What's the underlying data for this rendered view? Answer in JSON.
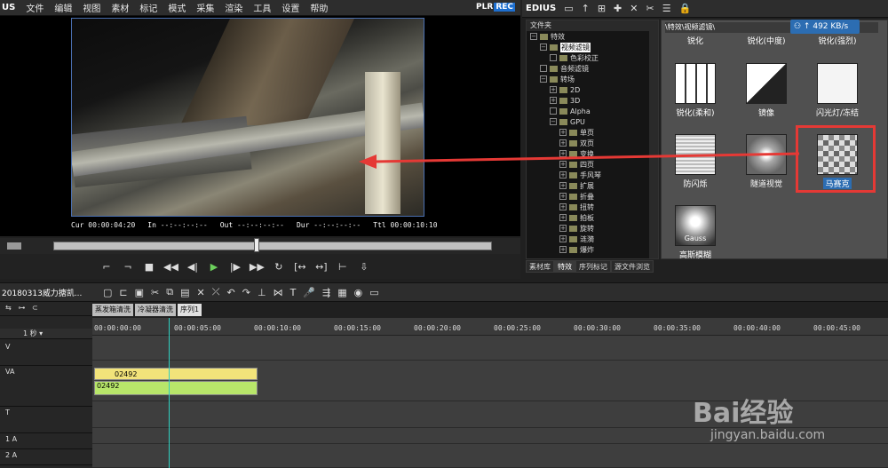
{
  "app": {
    "logo": "US",
    "menus": [
      "文件",
      "编辑",
      "视图",
      "素材",
      "标记",
      "模式",
      "采集",
      "渲染",
      "工具",
      "设置",
      "帮助"
    ],
    "plr": "PLR",
    "rec": "REC"
  },
  "player": {
    "cur_label": "Cur",
    "cur": "00:00:04:20",
    "in_label": "In",
    "in": "--:--:--:--",
    "out_label": "Out",
    "out": "--:--:--:--",
    "dur_label": "Dur",
    "dur": "--:--:--:--",
    "ttl_label": "Ttl",
    "ttl": "00:00:10:10"
  },
  "right": {
    "title": "EDIUS",
    "speed": "492 KB/s",
    "tree_header": "文件夹",
    "fx_path": "\\特效\\视频滤镜\\"
  },
  "tree": [
    {
      "label": "特效",
      "level": 0,
      "sign": "−"
    },
    {
      "label": "视频滤镜",
      "level": 1,
      "sign": "−",
      "selected": true
    },
    {
      "label": "色彩校正",
      "level": 2,
      "sign": ""
    },
    {
      "label": "音频滤镜",
      "level": 1,
      "sign": ""
    },
    {
      "label": "转场",
      "level": 1,
      "sign": "−"
    },
    {
      "label": "2D",
      "level": 2,
      "sign": "+"
    },
    {
      "label": "3D",
      "level": 2,
      "sign": "+"
    },
    {
      "label": "Alpha",
      "level": 2,
      "sign": ""
    },
    {
      "label": "GPU",
      "level": 2,
      "sign": "−"
    },
    {
      "label": "单页",
      "level": 3,
      "sign": "+"
    },
    {
      "label": "双页",
      "level": 3,
      "sign": "+"
    },
    {
      "label": "变换",
      "level": 3,
      "sign": "+"
    },
    {
      "label": "四页",
      "level": 3,
      "sign": "+"
    },
    {
      "label": "手风琴",
      "level": 3,
      "sign": "+"
    },
    {
      "label": "扩展",
      "level": 3,
      "sign": "+"
    },
    {
      "label": "折叠",
      "level": 3,
      "sign": "+"
    },
    {
      "label": "扭转",
      "level": 3,
      "sign": "+"
    },
    {
      "label": "拍板",
      "level": 3,
      "sign": "+"
    },
    {
      "label": "旋转",
      "level": 3,
      "sign": "+"
    },
    {
      "label": "涟漪",
      "level": 3,
      "sign": "+"
    },
    {
      "label": "爆炸",
      "level": 3,
      "sign": "+"
    }
  ],
  "tabs": [
    "素材库",
    "特效",
    "序列标记",
    "源文件浏览"
  ],
  "effects": [
    {
      "label": "锐化",
      "kind": "plain"
    },
    {
      "label": "锐化(中度)",
      "kind": "plain"
    },
    {
      "label": "锐化(强烈)",
      "kind": "plain"
    },
    {
      "label": "锐化(柔和)",
      "kind": "grid"
    },
    {
      "label": "镜像",
      "kind": "mirror"
    },
    {
      "label": "闪光灯/冻结",
      "kind": "camera"
    },
    {
      "label": "防闪烁",
      "kind": "lines"
    },
    {
      "label": "隧道视觉",
      "kind": "tunnel"
    },
    {
      "label": "马赛克",
      "kind": "mosaic"
    },
    {
      "label": "高斯模糊",
      "kind": "gauss",
      "overlay": "Gauss"
    }
  ],
  "timeline": {
    "project": "20180313威力搪凯...",
    "seq_tabs": [
      "蒸发箱清洗",
      "冷凝器清洗",
      "序列1"
    ],
    "scale": "1 秒",
    "ticks": [
      "00:00:00:00",
      "00:00:05:00",
      "00:00:10:00",
      "00:00:15:00",
      "00:00:20:00",
      "00:00:25:00",
      "00:00:30:00",
      "00:00:35:00",
      "00:00:40:00",
      "00:00:45:00"
    ],
    "tracks": [
      "V",
      "VA",
      "T",
      "1 A",
      "2 A"
    ],
    "clip_video": "02492",
    "clip_audio": "02492"
  },
  "watermark": {
    "brand": "Bai经验",
    "url": "jingyan.baidu.com"
  }
}
